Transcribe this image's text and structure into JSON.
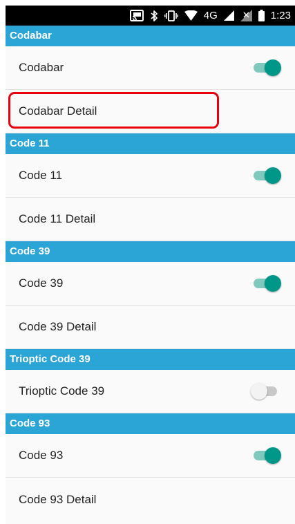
{
  "status_bar": {
    "network": "4G",
    "time": "1:23",
    "icons": [
      "cast-icon",
      "bluetooth-icon",
      "vibrate-icon",
      "wifi-icon",
      "signal-icon",
      "no-sim-icon",
      "battery-icon"
    ]
  },
  "colors": {
    "section_header": "#2aa5d6",
    "toggle_on": "#009688",
    "highlight": "#e8000d"
  },
  "sections": [
    {
      "header": "Codabar",
      "rows": [
        {
          "label": "Codabar",
          "type": "toggle",
          "checked": true
        },
        {
          "label": "Codabar Detail",
          "type": "link",
          "highlighted": true
        }
      ]
    },
    {
      "header": "Code 11",
      "rows": [
        {
          "label": "Code 11",
          "type": "toggle",
          "checked": true
        },
        {
          "label": "Code 11 Detail",
          "type": "link"
        }
      ]
    },
    {
      "header": "Code 39",
      "rows": [
        {
          "label": "Code 39",
          "type": "toggle",
          "checked": true
        },
        {
          "label": "Code 39 Detail",
          "type": "link"
        }
      ]
    },
    {
      "header": "Trioptic Code 39",
      "rows": [
        {
          "label": "Trioptic Code 39",
          "type": "toggle",
          "checked": false
        }
      ]
    },
    {
      "header": "Code 93",
      "rows": [
        {
          "label": "Code 93",
          "type": "toggle",
          "checked": true
        },
        {
          "label": "Code 93 Detail",
          "type": "link"
        }
      ]
    }
  ]
}
